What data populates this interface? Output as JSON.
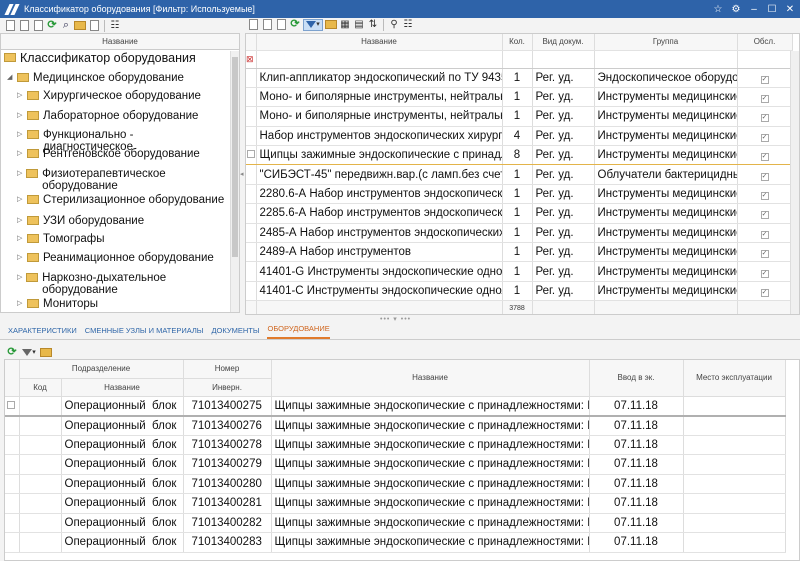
{
  "window": {
    "title": "Классификатор оборудования [Фильтр: Используемые]"
  },
  "tree": {
    "header": "Название",
    "nodes": [
      {
        "label": "Классификатор оборудования",
        "level": 0,
        "expanded": true
      },
      {
        "label": "Медицинское оборудование",
        "level": 1,
        "expanded": true
      },
      {
        "label": "Хирургическое оборудование",
        "level": 2
      },
      {
        "label": "Лабораторное оборудование",
        "level": 2
      },
      {
        "label": "Функционально - диагностическое",
        "level": 2
      },
      {
        "label": "Рентгеновское оборудование",
        "level": 2
      },
      {
        "label": "Физиотерапевтическое оборудование",
        "level": 2
      },
      {
        "label": "Стерилизационное оборудование",
        "level": 2
      },
      {
        "label": "УЗИ оборудование",
        "level": 2
      },
      {
        "label": "Томографы",
        "level": 2
      },
      {
        "label": "Реанимационное оборудование",
        "level": 2
      },
      {
        "label": "Наркозно-дыхательное оборудование",
        "level": 2
      },
      {
        "label": "Мониторы",
        "level": 2
      }
    ]
  },
  "grid": {
    "headers": {
      "name": "Название",
      "qty": "Кол.",
      "doctype": "Вид докум.",
      "group": "Группа",
      "serviced": "Обсл."
    },
    "rows": [
      {
        "name": "Клип-аппликатор эндоскопический по ТУ 9435-",
        "qty": "1",
        "doctype": "Рег. уд.",
        "group": "Эндоскопическое оборудов"
      },
      {
        "name": "Моно- и биполярные инструменты, нейтральн",
        "qty": "1",
        "doctype": "Рег. уд.",
        "group": "Инструменты медицинские"
      },
      {
        "name": "Моно- и биполярные инструменты, нейтральн",
        "qty": "1",
        "doctype": "Рег. уд.",
        "group": "Инструменты медицинские"
      },
      {
        "name": "Набор инструментов эндоскопических хирурги",
        "qty": "4",
        "doctype": "Рег. уд.",
        "group": "Инструменты медицинские"
      },
      {
        "name": "Щипцы зажимные эндоскопические с принадл",
        "qty": "8",
        "doctype": "Рег. уд.",
        "group": "Инструменты медицинские",
        "selected": true
      },
      {
        "name": "\"СИБЭСТ-45\" передвижн.вар.(с ламп.без счетч",
        "qty": "1",
        "doctype": "Рег. уд.",
        "group": "Облучатели бактерицидные"
      },
      {
        "name": "2280.6-А Набор инструментов эндоскопических",
        "qty": "1",
        "doctype": "Рег. уд.",
        "group": "Инструменты медицинские"
      },
      {
        "name": "2285.6-А Набор инструментов эндоскопических",
        "qty": "1",
        "doctype": "Рег. уд.",
        "group": "Инструменты медицинские"
      },
      {
        "name": "2485-А Набор инструментов эндоскопических х",
        "qty": "1",
        "doctype": "Рег. уд.",
        "group": "Инструменты медицинские"
      },
      {
        "name": "2489-А Набор инструментов",
        "qty": "1",
        "doctype": "Рег. уд.",
        "group": "Инструменты медицинские"
      },
      {
        "name": "41401-G Инструменты эндоскопические однол",
        "qty": "1",
        "doctype": "Рег. уд.",
        "group": "Инструменты медицинские"
      },
      {
        "name": "41401-C Инструменты эндоскопические однол",
        "qty": "1",
        "doctype": "Рег. уд.",
        "group": "Инструменты медицинские"
      }
    ],
    "total_qty": "3788"
  },
  "tabs": [
    {
      "label": "ХАРАКТЕРИСТИКИ"
    },
    {
      "label": "СМЕННЫЕ УЗЛЫ И МАТЕРИАЛЫ"
    },
    {
      "label": "ДОКУМЕНТЫ"
    },
    {
      "label": "ОБОРУДОВАНИЕ",
      "active": true
    }
  ],
  "bottom": {
    "headers": {
      "division": "Подразделение",
      "code": "Код",
      "div_name": "Название",
      "number": "Номер",
      "inv": "Инверн.",
      "name": "Название",
      "date": "Ввод в эк.",
      "place": "Место эксплуатации"
    },
    "rows": [
      {
        "code": "",
        "division": "Операционный  блок",
        "inv": "71013400275",
        "name": "Щипцы зажимные эндоскопические с принадлежностями: Щи",
        "date": "07.11.18",
        "place": ""
      },
      {
        "code": "",
        "division": "Операционный  блок",
        "inv": "71013400276",
        "name": "Щипцы зажимные эндоскопические с принадлежностями: Щи",
        "date": "07.11.18",
        "place": ""
      },
      {
        "code": "",
        "division": "Операционный  блок",
        "inv": "71013400278",
        "name": "Щипцы зажимные эндоскопические с принадлежностями: Щи",
        "date": "07.11.18",
        "place": ""
      },
      {
        "code": "",
        "division": "Операционный  блок",
        "inv": "71013400279",
        "name": "Щипцы зажимные эндоскопические с принадлежностями: Щи",
        "date": "07.11.18",
        "place": ""
      },
      {
        "code": "",
        "division": "Операционный  блок",
        "inv": "71013400280",
        "name": "Щипцы зажимные эндоскопические с принадлежностями: Щи",
        "date": "07.11.18",
        "place": ""
      },
      {
        "code": "",
        "division": "Операционный  блок",
        "inv": "71013400281",
        "name": "Щипцы зажимные эндоскопические с принадлежностями: Щи",
        "date": "07.11.18",
        "place": ""
      },
      {
        "code": "",
        "division": "Операционный  блок",
        "inv": "71013400282",
        "name": "Щипцы зажимные эндоскопические с принадлежностями: Щи",
        "date": "07.11.18",
        "place": ""
      },
      {
        "code": "",
        "division": "Операционный  блок",
        "inv": "71013400283",
        "name": "Щипцы зажимные эндоскопические с принадлежностями: Щи",
        "date": "07.11.18",
        "place": ""
      }
    ]
  }
}
